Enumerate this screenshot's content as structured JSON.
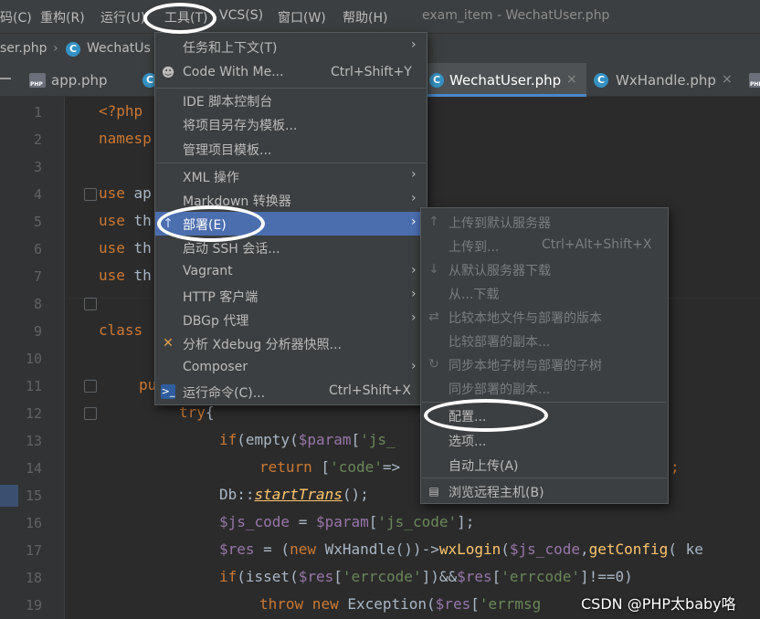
{
  "menubar": {
    "items": [
      "码(C)",
      "重构(R)",
      "运行(U)",
      "工具(T)",
      "VCS(S)",
      "窗口(W)",
      "帮助(H)"
    ],
    "window_title": "exam_item - WechatUser.php"
  },
  "breadcrumb": {
    "items": [
      "ser.php",
      "WechatUs"
    ]
  },
  "tabs": [
    {
      "label": "app.php",
      "icon": "php-file-icon"
    },
    {
      "label": "WechatUser.php",
      "icon": "class-icon",
      "active": true,
      "close": "×"
    },
    {
      "label": "WxHandle.php",
      "icon": "class-icon",
      "close": "×"
    }
  ],
  "editor": {
    "line_numbers": [
      "1",
      "2",
      "3",
      "4",
      "5",
      "6",
      "7",
      "8",
      "9",
      "10",
      "11",
      "12",
      "13",
      "14",
      "15",
      "16",
      "17",
      "18",
      "19"
    ],
    "lines": {
      "l1": "<?php",
      "l2": "namesp",
      "l4_kw": "use",
      "l4": " ap",
      "l5_kw": "use",
      "l5": " th",
      "l6_kw": "use",
      "l6": " th",
      "l7_kw": "use",
      "l7": " th",
      "l9": "class",
      "l11": "pu",
      "l12_kw": "try",
      "l12": "{",
      "l13_kw": "if",
      "l13_a": "(empty(",
      "l13_var": "$param",
      "l13_b": "[",
      "l13_str": "'js_",
      "l14_kw": "return",
      "l14_a": " [",
      "l14_str": "'code'",
      "l14_b": "=>",
      "l14_end": ";",
      "l15_a": "Db::",
      "l15_fn": "startTrans",
      "l15_b": "();",
      "l16_var": "$js_code",
      "l16_a": " = ",
      "l16_var2": "$param",
      "l16_b": "[",
      "l16_str": "'js_code'",
      "l16_c": "];",
      "l17_var": "$res",
      "l17_a": " = (",
      "l17_kw": "new",
      "l17_b": " WxHandle())->",
      "l17_fn": "wxLogin",
      "l17_c": "(",
      "l17_var2": "$js_code",
      "l17_d": ",",
      "l17_fn2": "getConfig",
      "l17_e": "( ke",
      "l18_kw": "if",
      "l18_a": "(isset(",
      "l18_var": "$res",
      "l18_b": "[",
      "l18_str": "'errcode'",
      "l18_c": "])&&",
      "l18_var2": "$res",
      "l18_d": "[",
      "l18_str2": "'errcode'",
      "l18_e": "]!==0)",
      "l19_kw": "throw",
      "l19_kw2": " new",
      "l19_a": " Exception(",
      "l19_var": "$res",
      "l19_b": "[",
      "l19_str": "'errmsg"
    }
  },
  "tools_menu": {
    "items": [
      {
        "label": "任务和上下文(T)",
        "submenu": true
      },
      {
        "label": "Code With Me...",
        "shortcut": "Ctrl+Shift+Y",
        "icon": "user-icon"
      },
      {
        "label": "IDE 脚本控制台"
      },
      {
        "label": "将项目另存为模板..."
      },
      {
        "label": "管理项目模板..."
      },
      {
        "label": "XML 操作",
        "submenu": true
      },
      {
        "label": "Markdown 转换器",
        "submenu": true
      },
      {
        "label": "部署(E)",
        "submenu": true,
        "selected": true,
        "icon": "upload-icon"
      },
      {
        "label": "启动 SSH 会话..."
      },
      {
        "label": "Vagrant",
        "submenu": true
      },
      {
        "label": "HTTP 客户端",
        "submenu": true
      },
      {
        "label": "DBGp 代理",
        "submenu": true
      },
      {
        "label": "分析 Xdebug 分析器快照...",
        "icon": "xdebug-icon"
      },
      {
        "label": "Composer",
        "submenu": true
      },
      {
        "label": "运行命令(C)...",
        "shortcut": "Ctrl+Shift+X",
        "icon": "terminal-icon"
      }
    ],
    "arrow": "›"
  },
  "deploy_menu": {
    "items": [
      {
        "label": "上传到默认服务器",
        "disabled": true,
        "icon": "upload-icon"
      },
      {
        "label": "上传到...",
        "shortcut": "Ctrl+Alt+Shift+X",
        "disabled": true
      },
      {
        "label": "从默认服务器下载",
        "disabled": true,
        "icon": "download-icon"
      },
      {
        "label": "从...下载",
        "disabled": true
      },
      {
        "label": "比较本地文件与部署的版本",
        "disabled": true,
        "icon": "compare-icon"
      },
      {
        "label": "比较部署的副本...",
        "disabled": true
      },
      {
        "label": "同步本地子树与部署的子树",
        "disabled": true,
        "icon": "sync-icon"
      },
      {
        "label": "同步部署的副本...",
        "disabled": true
      },
      {
        "label": "配置..."
      },
      {
        "label": "选项..."
      },
      {
        "label": "自动上传(A)"
      },
      {
        "label": "浏览远程主机(B)",
        "icon": "remote-host-icon"
      }
    ]
  },
  "watermark": "CSDN @PHP太baby咯",
  "colors": {
    "menubar_bg": "#3c3f41",
    "editor_bg": "#2b2b2b",
    "selection": "#4b6eaf",
    "keyword": "#cc7832",
    "string": "#6a8759",
    "variable": "#9876aa",
    "function": "#ffc66d"
  }
}
